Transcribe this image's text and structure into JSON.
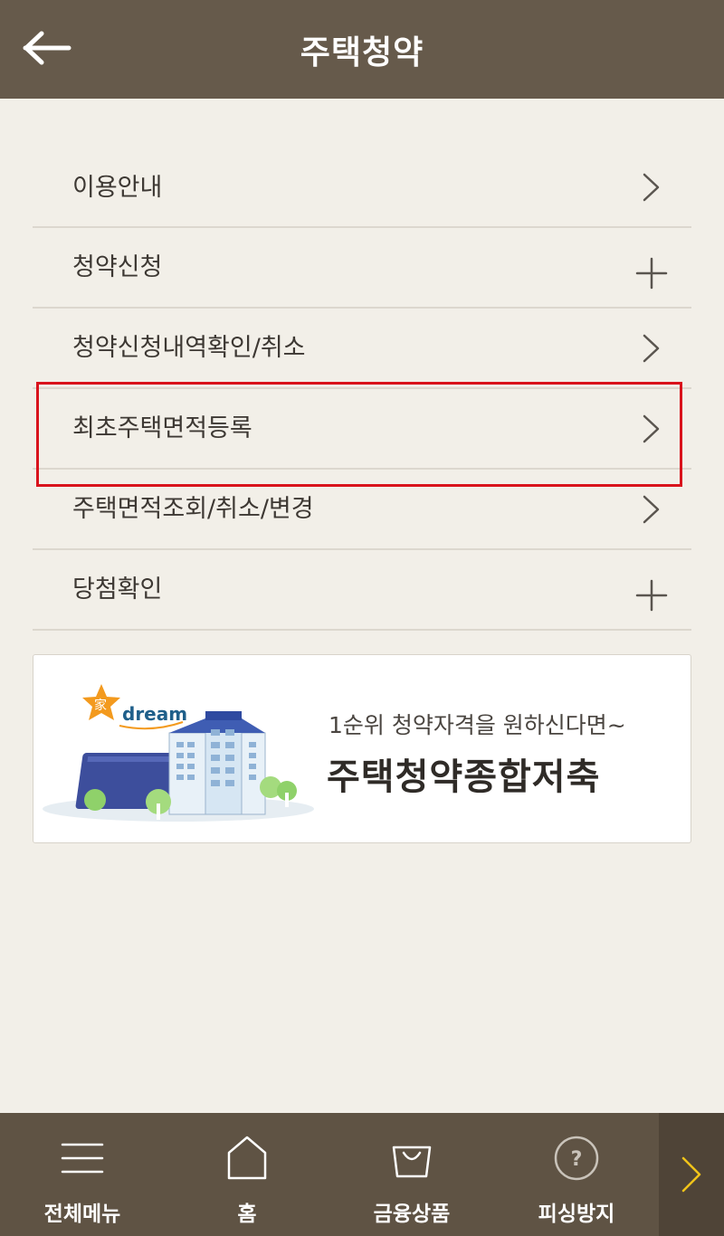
{
  "header": {
    "title": "주택청약",
    "back_icon": "arrow-left-icon"
  },
  "menu": {
    "items": [
      {
        "label": "이용안내",
        "icon": "chevron-right-icon"
      },
      {
        "label": "청약신청",
        "icon": "plus-icon"
      },
      {
        "label": "청약신청내역확인/취소",
        "icon": "chevron-right-icon"
      },
      {
        "label": "최초주택면적등록",
        "icon": "chevron-right-icon"
      },
      {
        "label": "주택면적조회/취소/변경",
        "icon": "chevron-right-icon"
      },
      {
        "label": "당첨확인",
        "icon": "plus-icon"
      }
    ],
    "highlight_color": "#d9131c"
  },
  "banner": {
    "logo_text": "dream",
    "subtitle": "1순위 청약자격을 원하신다면~",
    "title": "주택청약종합저축"
  },
  "bottom_nav": {
    "tabs": [
      {
        "label": "전체메뉴",
        "icon": "hamburger-menu-icon"
      },
      {
        "label": "홈",
        "icon": "home-icon"
      },
      {
        "label": "금융상품",
        "icon": "shopping-bag-icon"
      },
      {
        "label": "피싱방지",
        "icon": "question-circle-icon"
      }
    ],
    "next_icon": "chevron-right-icon"
  },
  "colors": {
    "header_bg": "#665a4b",
    "page_bg": "#f2efe8",
    "nav_bg": "#5f5344",
    "next_arrow": "#f0c419"
  }
}
